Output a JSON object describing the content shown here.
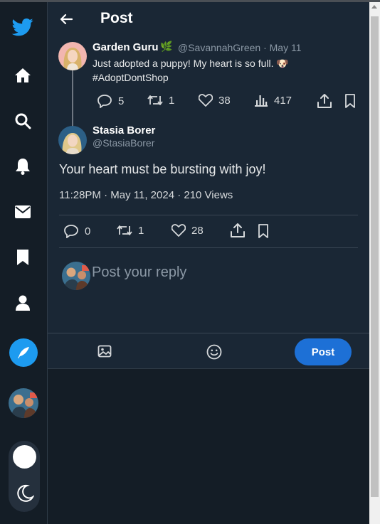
{
  "colors": {
    "accent": "#1d9bf0",
    "background": "#141d26",
    "panel": "#1a2735",
    "muted_text": "#8b98a5"
  },
  "sidebar": {
    "items": [
      {
        "icon": "twitter-bird-icon"
      },
      {
        "icon": "home-icon"
      },
      {
        "icon": "search-icon"
      },
      {
        "icon": "bell-icon"
      },
      {
        "icon": "mail-icon"
      },
      {
        "icon": "bookmark-icon"
      },
      {
        "icon": "profile-icon"
      },
      {
        "icon": "feather-icon"
      }
    ],
    "theme_toggle": {
      "mode": "dark",
      "icon": "moon-icon"
    }
  },
  "header": {
    "title": "Post"
  },
  "original_post": {
    "author_name": "Garden Guru",
    "author_emoji": "🌿",
    "handle_date": "@SavannahGreen · May 11",
    "text_line1": "Just adopted a puppy! My heart is so full. 🐶",
    "text_line2": "#AdoptDontShop",
    "replies": "5",
    "reposts": "1",
    "likes": "38",
    "views": "417"
  },
  "reply_post": {
    "author_name": "Stasia Borer",
    "handle": "@StasiaBorer",
    "text": "Your heart must be bursting with joy!",
    "timestamp_views": "11:28PM · May 11, 2024 · 210 Views",
    "replies": "0",
    "reposts": "1",
    "likes": "28"
  },
  "composer": {
    "placeholder": "Post your reply",
    "post_label": "Post"
  }
}
